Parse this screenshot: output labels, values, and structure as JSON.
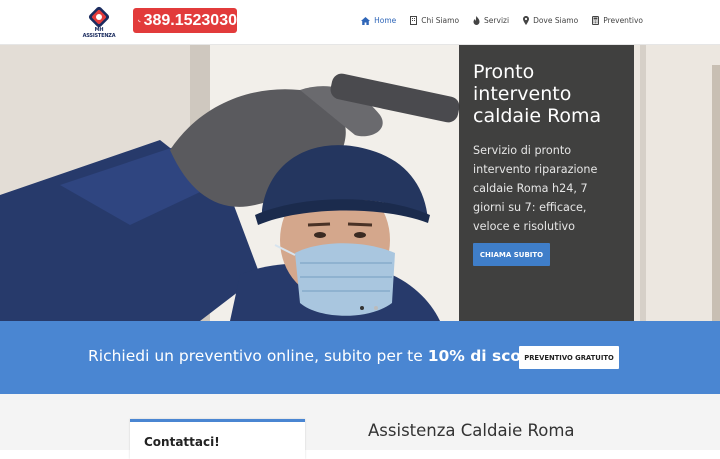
{
  "header": {
    "logo_text": "MH ASSISTENZA",
    "phone": "389.1523030",
    "nav": [
      {
        "label": "Home",
        "icon": "home-icon",
        "active": true
      },
      {
        "label": "Chi Siamo",
        "icon": "building-icon",
        "active": false
      },
      {
        "label": "Servizi",
        "icon": "fire-icon",
        "active": false
      },
      {
        "label": "Dove Siamo",
        "icon": "map-marker-icon",
        "active": false
      },
      {
        "label": "Preventivo",
        "icon": "calculator-icon",
        "active": false
      }
    ]
  },
  "hero": {
    "title": "Pronto intervento caldaie Roma",
    "description": "Servizio di pronto intervento riparazione caldaie Roma h24, 7 giorni su 7: efficace, veloce e risolutivo",
    "button": "CHIAMA SUBITO",
    "slides": 2,
    "active_slide": 1
  },
  "promo": {
    "text_prefix": "Richiedi un preventivo online, subito per te ",
    "text_bold": "10% di sconto",
    "button": "PREVENTIVO GRATUITO"
  },
  "bottom": {
    "contact_title": "Contattaci!",
    "section_title": "Assistenza Caldaie Roma"
  },
  "colors": {
    "accent": "#4a86d2",
    "phone_red": "#e23b3b",
    "nav_active": "#2f66b8"
  }
}
